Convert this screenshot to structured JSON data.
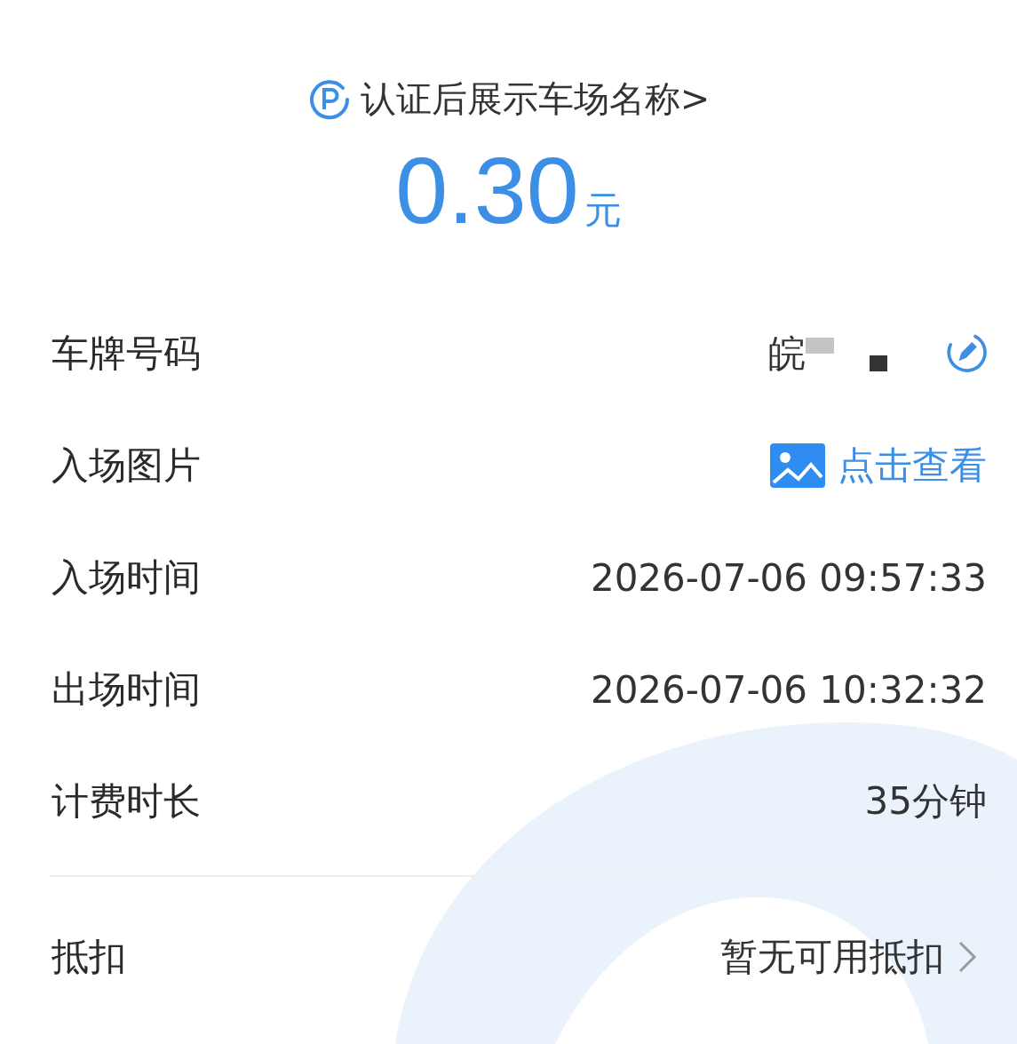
{
  "header": {
    "title": "认证后展示车场名称>"
  },
  "amount": {
    "value": "0.30",
    "unit": "元"
  },
  "rows": [
    {
      "kind": "plate",
      "label": "车牌号码",
      "value": "皖"
    },
    {
      "kind": "link",
      "label": "入场图片",
      "value": "点击查看"
    },
    {
      "kind": "text",
      "label": "入场时间",
      "value": "2026-07-06 09:57:33"
    },
    {
      "kind": "text",
      "label": "出场时间",
      "value": "2026-07-06 10:32:32"
    },
    {
      "kind": "text",
      "label": "计费时长",
      "value": "35分钟"
    }
  ],
  "deduction": {
    "label": "抵扣",
    "value": "暂无可用抵扣"
  }
}
